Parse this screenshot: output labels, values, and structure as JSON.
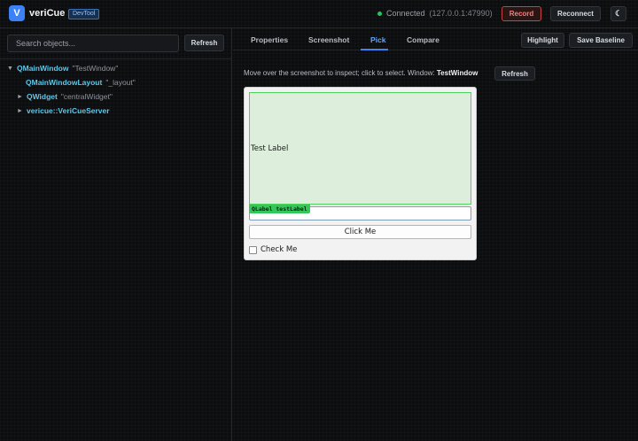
{
  "app": {
    "logo_letter": "V",
    "title": "veriCue",
    "badge": "DevTool"
  },
  "connection": {
    "status": "Connected",
    "address": "(127.0.0.1:47990)"
  },
  "header_buttons": {
    "record": "Record",
    "reconnect": "Reconnect",
    "theme_icon": "☾"
  },
  "sidebar": {
    "search_placeholder": "Search objects...",
    "refresh": "Refresh",
    "tree": [
      {
        "arrow": "▼",
        "cls": "QMainWindow",
        "name": "\"TestWindow\""
      },
      {
        "arrow": "",
        "cls": "QMainWindowLayout",
        "name": "\"_layout\""
      },
      {
        "arrow": "►",
        "cls": "QWidget",
        "name": "\"centralWidget\""
      },
      {
        "arrow": "►",
        "cls": "vericue::VeriCueServer",
        "name": ""
      }
    ]
  },
  "tabs": [
    "Properties",
    "Screenshot",
    "Pick",
    "Compare"
  ],
  "active_tab": "Pick",
  "toolbar": {
    "highlight": "Highlight",
    "save_baseline": "Save Baseline"
  },
  "pick": {
    "hint": "Move over the screenshot to inspect; click to select. Window:",
    "window_name": "TestWindow",
    "refresh": "Refresh",
    "tag": "QLabel testLabel"
  },
  "preview": {
    "label_text": "Test Label",
    "button_text": "Click Me",
    "checkbox_text": "Check Me"
  },
  "colors": {
    "accent": "#3b82f6",
    "pick_highlight": "#34c759",
    "record": "#c2453f",
    "connected": "#22c55e"
  }
}
